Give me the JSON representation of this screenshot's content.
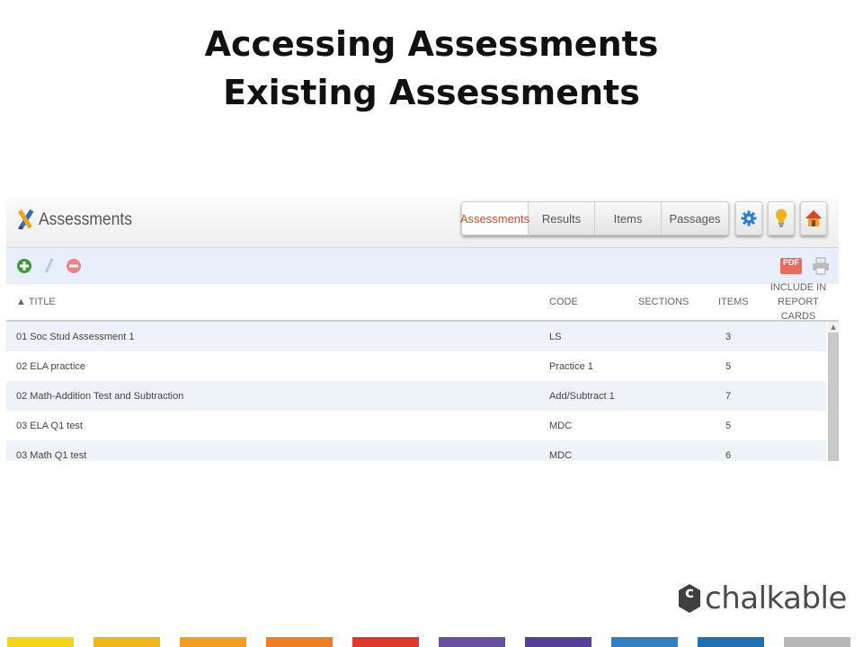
{
  "slide": {
    "title_line1": "Accessing Assessments",
    "title_line2": "Existing Assessments"
  },
  "app": {
    "name": "Assessments",
    "tabs": [
      {
        "label": "Assessments",
        "active": true
      },
      {
        "label": "Results",
        "active": false
      },
      {
        "label": "Items",
        "active": false
      },
      {
        "label": "Passages",
        "active": false
      }
    ],
    "header_buttons": [
      {
        "icon": "gear-icon"
      },
      {
        "icon": "lightbulb-icon"
      },
      {
        "icon": "home-icon"
      }
    ],
    "toolbar": {
      "left_icons": [
        "add-icon",
        "edit-pencil-icon",
        "remove-icon"
      ],
      "pdf_label": "PDF",
      "right_icons": [
        "pdf-icon",
        "print-icon"
      ]
    },
    "columns": {
      "title": "▲ TITLE",
      "code": "CODE",
      "sections": "SECTIONS",
      "items": "ITEMS",
      "include_line1": "INCLUDE IN",
      "include_line2": "REPORT CARDS"
    },
    "rows": [
      {
        "title": "01 Soc Stud Assessment 1",
        "code": "LS",
        "sections": "",
        "items": "3"
      },
      {
        "title": "02 ELA practice",
        "code": "Practice 1",
        "sections": "",
        "items": "5"
      },
      {
        "title": "02 Math-Addition Test and Subtraction",
        "code": "Add/Subtract 1",
        "sections": "",
        "items": "7"
      },
      {
        "title": "03 ELA Q1 test",
        "code": "MDC",
        "sections": "",
        "items": "5"
      },
      {
        "title": "03 Math Q1 test",
        "code": "MDC",
        "sections": "",
        "items": "6"
      }
    ]
  },
  "brand": {
    "name": "chalkable",
    "logo_letter": "c"
  },
  "colors": {
    "accent_tab": "#d44c2c",
    "toolbar_bg": "#e8eefa",
    "row_alt": "#eef2f9",
    "stripes": [
      "#f7d417",
      "#f1b619",
      "#f59c22",
      "#ef7d23",
      "#e03a2d",
      "#6a4fa3",
      "#553f9a",
      "#2f7fc1",
      "#1f6fb5",
      "#b7b7b7"
    ]
  }
}
